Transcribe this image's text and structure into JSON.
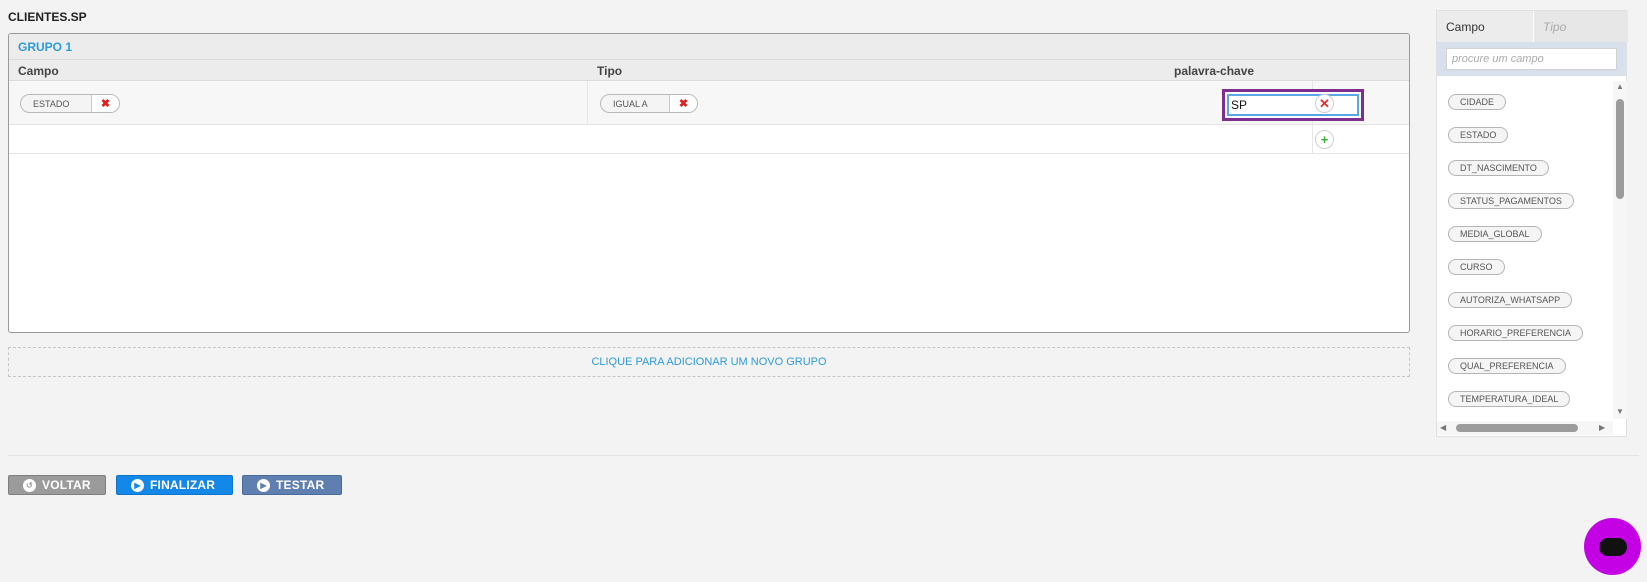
{
  "page_title": "CLIENTES.SP",
  "group": {
    "title": "GRUPO 1",
    "columns": [
      "Campo",
      "Tipo",
      "palavra-chave"
    ],
    "rule": {
      "campo": "ESTADO",
      "tipo": "IGUAL A",
      "palavra_chave": "SP"
    },
    "remove_glyph": "✖",
    "delete_glyph": "✕",
    "add_glyph": "+"
  },
  "add_group_label": "CLIQUE PARA ADICIONAR UM NOVO GRUPO",
  "buttons": {
    "voltar": "VOLTAR",
    "finalizar": "FINALIZAR",
    "testar": "TESTAR"
  },
  "panel": {
    "tabs": [
      "Campo",
      "Tipo"
    ],
    "search_placeholder": "procure um campo",
    "fields": [
      "CIDADE",
      "ESTADO",
      "DT_NASCIMENTO",
      "STATUS_PAGAMENTOS",
      "MEDIA_GLOBAL",
      "CURSO",
      "AUTORIZA_WHATSAPP",
      "HORARIO_PREFERENCIA",
      "QUAL_PREFERENCIA",
      "TEMPERATURA_IDEAL"
    ]
  },
  "colors": {
    "accent": "#2d9bd8",
    "finalizar": "#1388e8",
    "testar": "#5f7fb1",
    "voltar": "#9b9b9b",
    "chat": "#c400e5"
  },
  "icons": {
    "voltar": "undo-circle-icon",
    "finalizar": "play-circle-icon",
    "testar": "play-circle-icon",
    "chat": "chat-icon"
  }
}
